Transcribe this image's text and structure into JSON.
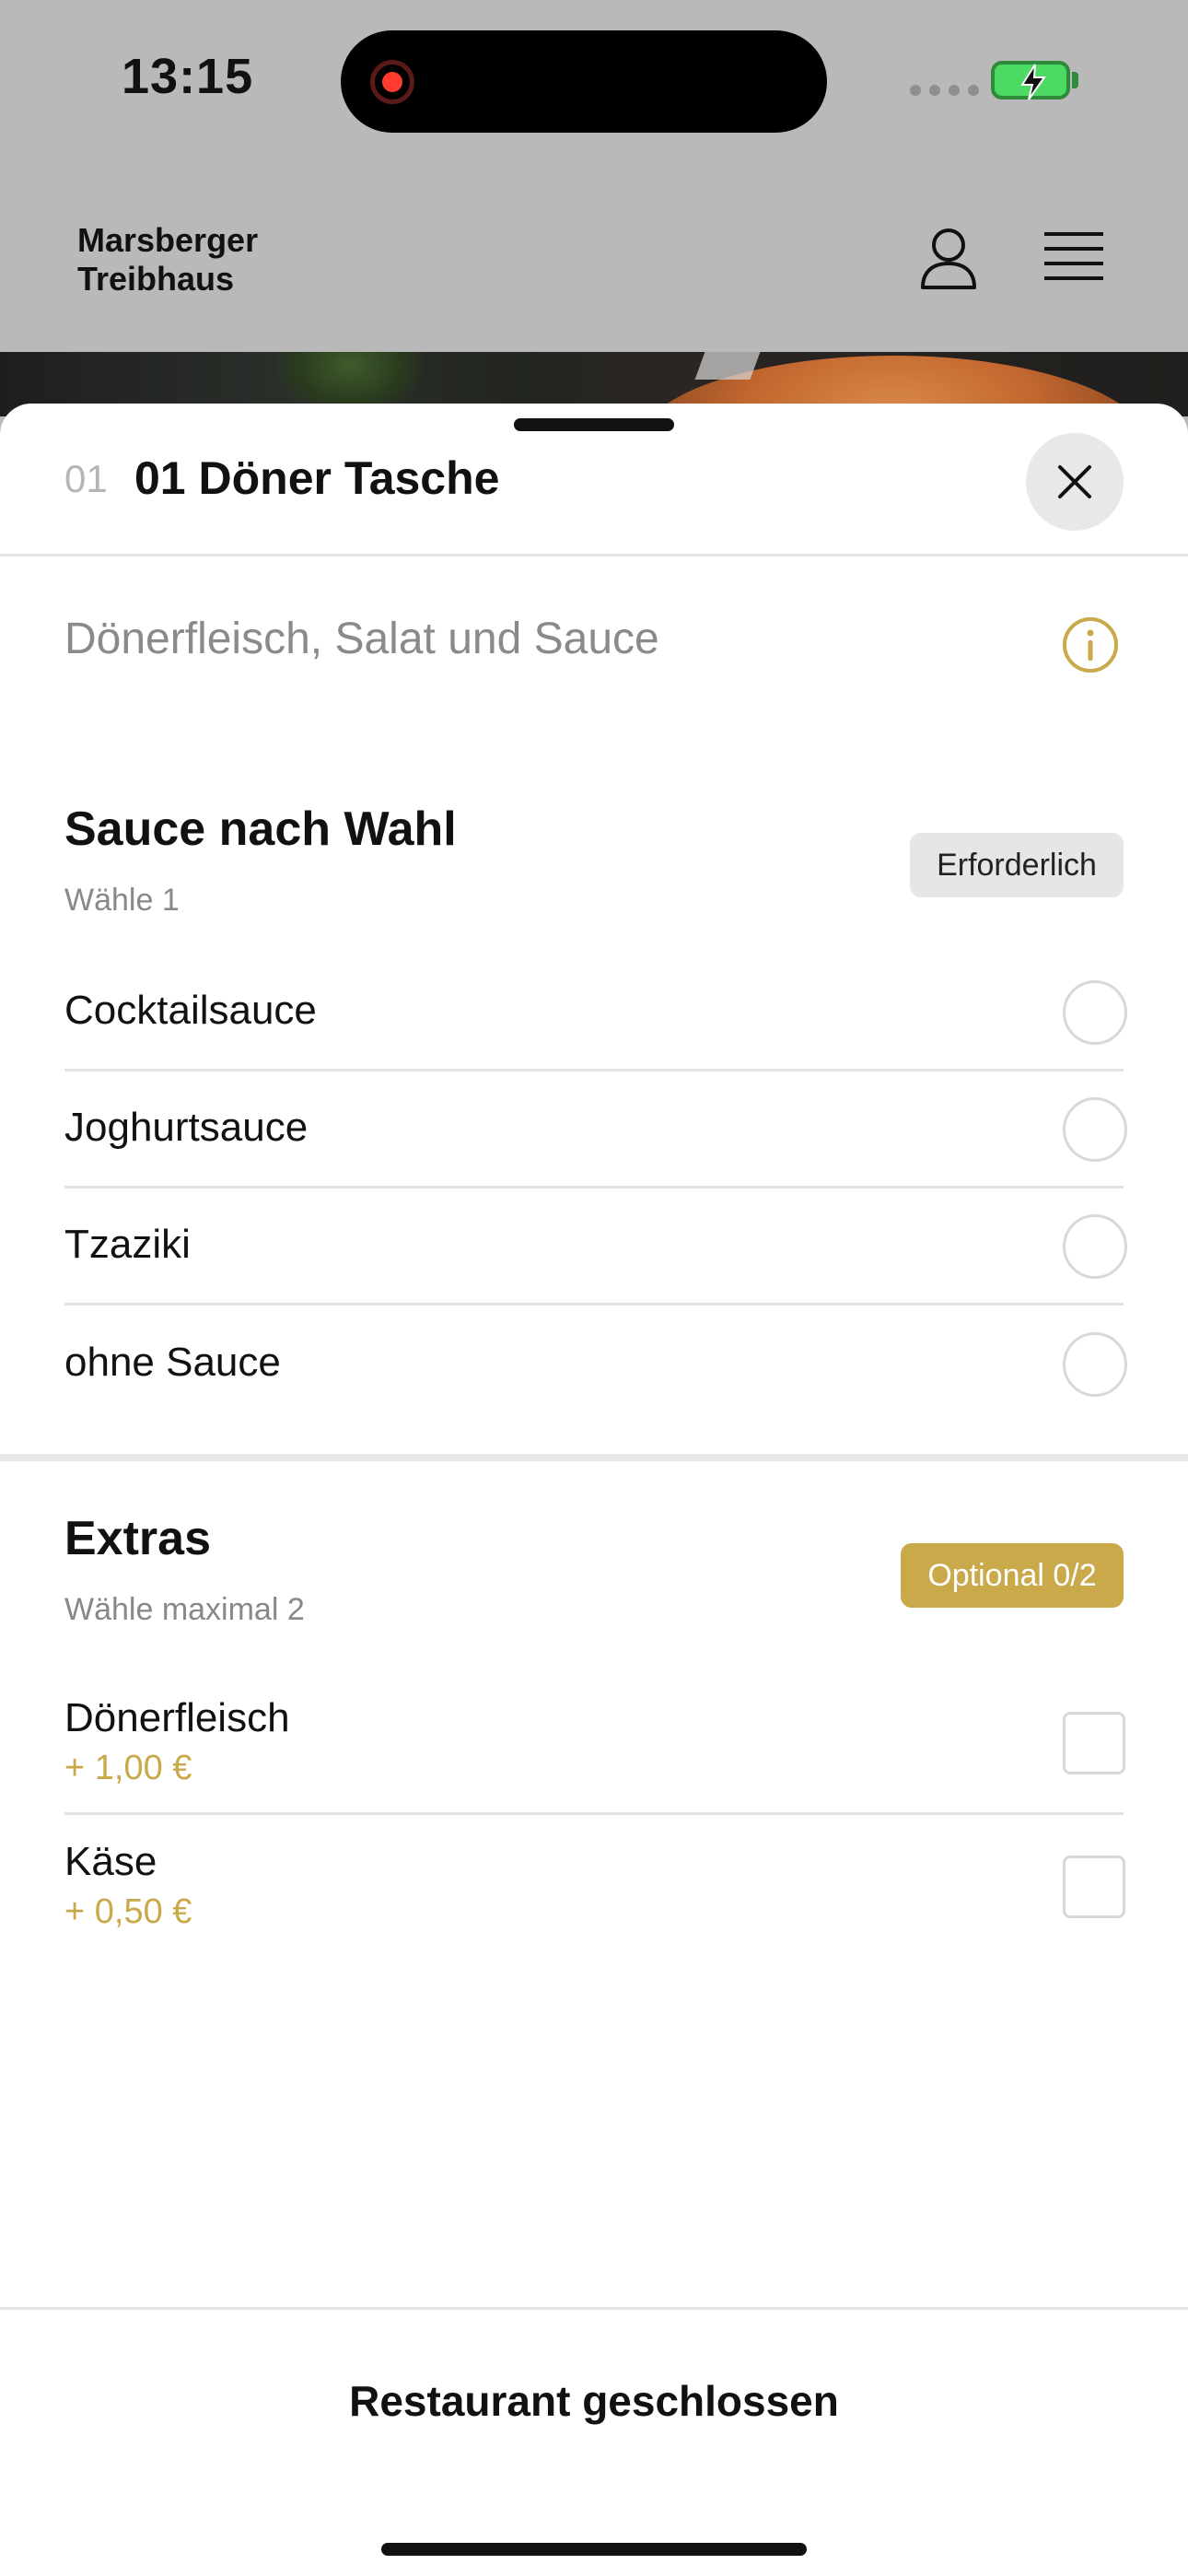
{
  "status_bar": {
    "time": "13:15",
    "recording_icon": "record-dot-icon",
    "battery_icon": "battery-charging-icon",
    "colors": {
      "recording": "#ff3b30",
      "battery": "#4cd964"
    }
  },
  "header": {
    "brand_line1": "Marsberger",
    "brand_line2": "Treibhaus",
    "account_icon": "user-icon",
    "menu_icon": "hamburger-menu-icon"
  },
  "product": {
    "number": "01",
    "title": "01 Döner Tasche",
    "description": "Dönerfleisch, Salat und Sauce",
    "close_icon": "close-icon",
    "info_icon": "info-icon"
  },
  "sauce_group": {
    "title": "Sauce nach Wahl",
    "subtitle": "Wähle 1",
    "badge": "Erforderlich",
    "options": [
      {
        "label": "Cocktailsauce"
      },
      {
        "label": "Joghurtsauce"
      },
      {
        "label": "Tzaziki"
      },
      {
        "label": "ohne Sauce"
      }
    ]
  },
  "extras_group": {
    "title": "Extras",
    "subtitle": "Wähle maximal 2",
    "badge": "Optional 0/2",
    "options": [
      {
        "label": "Dönerfleisch",
        "price": "+ 1,00 €"
      },
      {
        "label": "Käse",
        "price": "+ 0,50 €"
      }
    ]
  },
  "footer": {
    "button_label": "Restaurant geschlossen"
  },
  "colors": {
    "accent": "#c9a94a",
    "text": "#111111",
    "muted": "#8a8a8a"
  }
}
